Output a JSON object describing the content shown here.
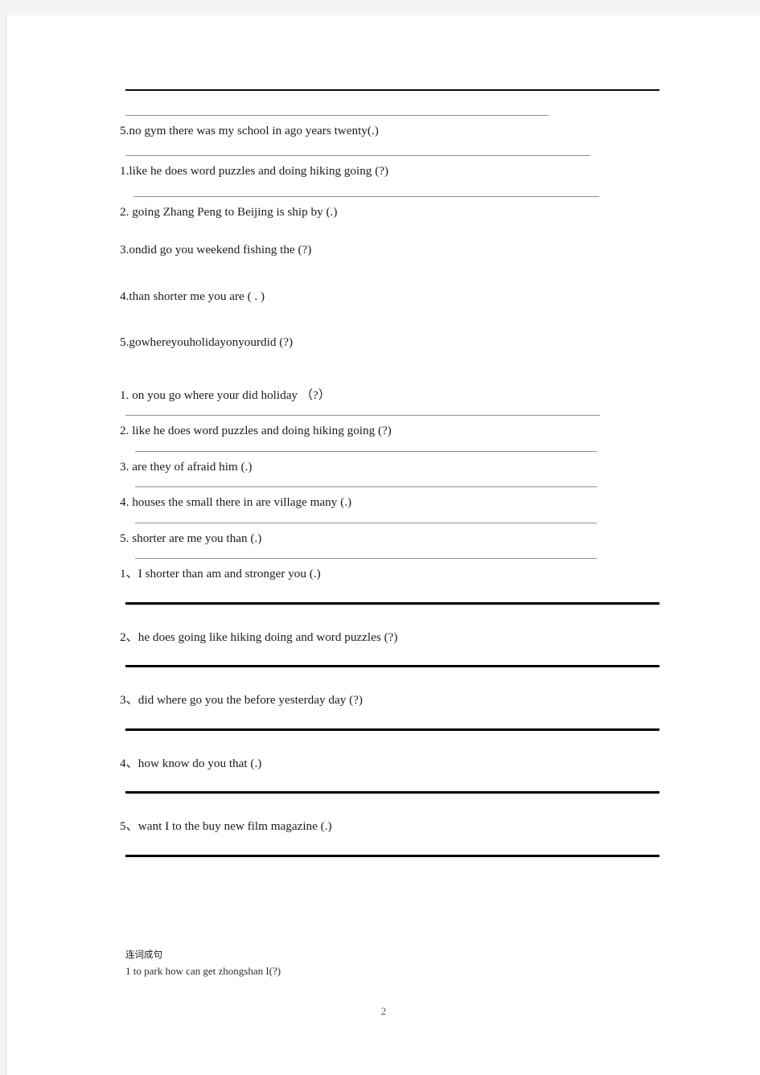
{
  "document": {
    "page_number": "2",
    "footer_heading": "连词成句",
    "footer_sentence": "1 to park   how can get zhongshan I(?)"
  },
  "section_a": {
    "items": [
      {
        "id": "a1",
        "text": "5.no   gym   there   was   my    school   in   ago   years   twenty(.)"
      },
      {
        "id": "a2",
        "text": "1.like   he   does   word    puzzles   and   doing   hiking    going (?)"
      },
      {
        "id": "a3",
        "text": "2. going   Zhang   Peng   to   Beijing   is   ship   by     (.)"
      },
      {
        "id": "a4",
        "text": "3.ondid  go  you  weekend  fishing  the  (?)"
      },
      {
        "id": "a5",
        "text": "4.than     shorter  me   you   are    ( . )"
      },
      {
        "id": "a6",
        "text": "5.gowhereyouholidayonyourdid  (?)"
      }
    ]
  },
  "section_b": {
    "items": [
      {
        "id": "b1",
        "text": "1. on    you      go       where     your      did     holiday    （?）"
      },
      {
        "id": "b2",
        "text": "2. like   he   does    word    puzzles    and    doing    hiking    going (?)"
      },
      {
        "id": "b3",
        "text": "3. are    they    of    afraid    him      (.)"
      },
      {
        "id": "b4",
        "text": "4. houses   the    small   there    in     are    village    many    (.)"
      },
      {
        "id": "b5",
        "text": "5. shorter   are    me    you     than      (.)"
      }
    ]
  },
  "section_c": {
    "items": [
      {
        "id": "c1",
        "text": "1、I    shorter    than   am   and   stronger    you (.)"
      },
      {
        "id": "c2",
        "text": "2、he    does   going    like   hiking   doing   and    word    puzzles (?)"
      },
      {
        "id": "c3",
        "text": "3、did   where   go   you   the   before   yesterday    day (?)"
      },
      {
        "id": "c4",
        "text": "4、how    know    do    you     that   (.)"
      },
      {
        "id": "c5",
        "text": "5、want   I   to    the    buy   new   film    magazine    (.)"
      }
    ]
  },
  "colors": {
    "page_background": "#ffffff",
    "canvas_background": "#f4f4f4",
    "text": "#1b1b23",
    "rule_gray": "#8e8e90",
    "rule_black": "#000000"
  }
}
